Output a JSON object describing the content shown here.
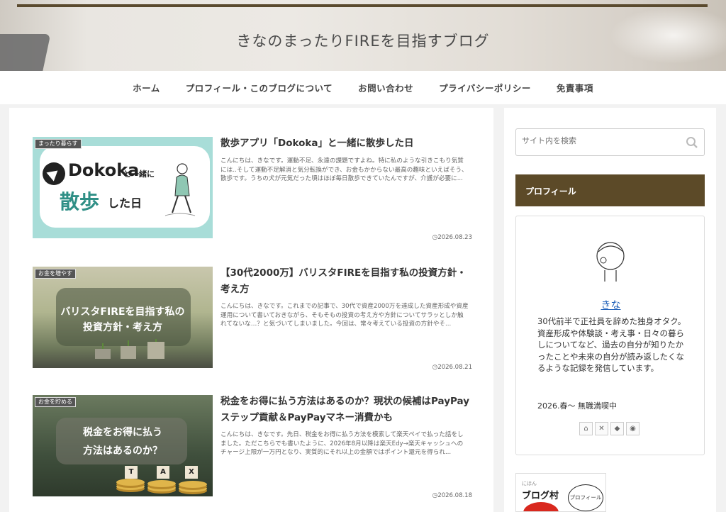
{
  "header": {
    "site_title": "きなのまったりFIREを目指すブログ"
  },
  "nav": [
    "ホーム",
    "プロフィール・このブログについて",
    "お問い合わせ",
    "プライバシーポリシー",
    "免責事項"
  ],
  "posts": [
    {
      "category": "まったり暮らす",
      "title": "散歩アプリ「Dokoka」と一緒に散歩した日",
      "excerpt": "こんにちは、きなです。運動不足、永遠の課題ですよね。特に私のような引きこもり気質には‥そして運動不足解消と気分転換ができ、お金もかからない最高の趣味といえばそう、散歩です。うちの犬が元気だった頃はほぼ毎日散歩できていたんですが、介護が必要に...",
      "date": "2026.08.23",
      "thumb": {
        "word1": "Dokoka",
        "word2": "と一緒に",
        "word3": "散歩",
        "word4": "した日"
      }
    },
    {
      "category": "お金を増やす",
      "title": "【30代2000万】バリスタFIREを目指す私の投資方針・考え方",
      "excerpt": "こんにちは、きなです。これまでの記事で、30代で資産2000万を達成した資産形成や資産運用について書いておきながら、そもそもの投資の考え方や方針についてサラッとしか触れてないな…？と気づいてしまいました。今回は、常々考えている投資の方針やそ...",
      "date": "2026.08.21",
      "thumb": {
        "line1": "バリスタFIREを目指す私の",
        "line2": "投資方針・考え方"
      }
    },
    {
      "category": "お金を貯める",
      "title": "税金をお得に払う方法はあるのか？現状の候補はPayPayステップ貢献＆PayPayマネー消費かも",
      "excerpt": "こんにちは、きなです。先日、税金をお得に払う方法を模索して楽天ペイで払った話をしました。ただこちらでも書いたように、2026年8月以降は楽天Edy→楽天キャッシュへのチャージ上限が一万円となり、実質的にそれ以上の金額ではポイント還元を得られ...",
      "date": "2026.08.18",
      "thumb": {
        "line1": "税金をお得に払う",
        "line2": "方法はあるのか？",
        "tiles": [
          "T",
          "A",
          "X"
        ]
      }
    }
  ],
  "sidebar": {
    "search_placeholder": "サイト内を検索",
    "profile_heading": "プロフィール",
    "profile_name": "きな",
    "profile_bio": "30代前半で正社員を辞めた独身オタク。資産形成や体験談・考え事・日々の暮らしについてなど、過去の自分が知りたかったことや未来の自分が読み返したくなるような記録を発信しています。",
    "profile_status": "2026.春〜 無職満喫中",
    "social_icons": [
      "home-icon",
      "x-icon",
      "feedly-icon",
      "rss-icon"
    ],
    "banner": {
      "sub": "にほん",
      "title": "ブログ村",
      "badge": "プロフィール"
    }
  }
}
